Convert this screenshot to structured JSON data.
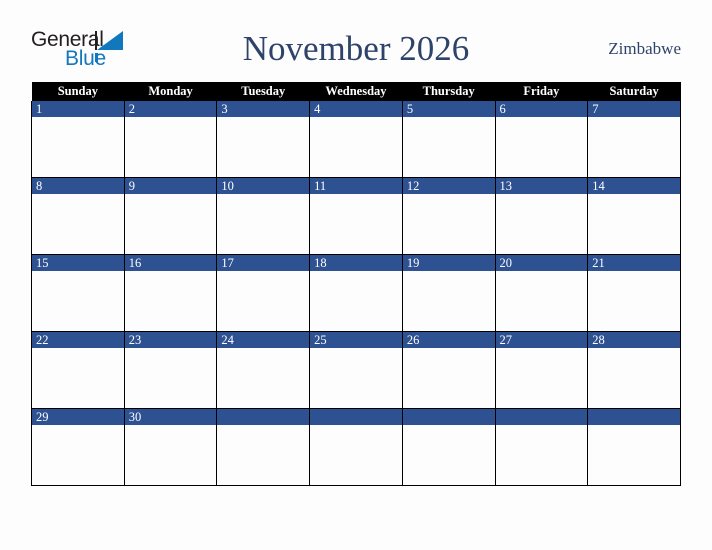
{
  "logo": {
    "word_one": "General",
    "word_two": "Blue",
    "triangle_icon": "blue-triangle-icon",
    "color_dark": "#231f20",
    "color_blue": "#1278be"
  },
  "header": {
    "title": "November 2026",
    "country": "Zimbabwe",
    "title_color": "#2e4369"
  },
  "calendar": {
    "weekday_headers": [
      "Sunday",
      "Monday",
      "Tuesday",
      "Wednesday",
      "Thursday",
      "Friday",
      "Saturday"
    ],
    "header_bg": "#000000",
    "header_text_color": "#ffffff",
    "daynum_bg": "#2e5192",
    "daynum_text_color": "#ffffff",
    "cell_bg": "#fdfdfd",
    "grid_line_color": "#000000",
    "weeks": [
      [
        {
          "day": "1"
        },
        {
          "day": "2"
        },
        {
          "day": "3"
        },
        {
          "day": "4"
        },
        {
          "day": "5"
        },
        {
          "day": "6"
        },
        {
          "day": "7"
        }
      ],
      [
        {
          "day": "8"
        },
        {
          "day": "9"
        },
        {
          "day": "10"
        },
        {
          "day": "11"
        },
        {
          "day": "12"
        },
        {
          "day": "13"
        },
        {
          "day": "14"
        }
      ],
      [
        {
          "day": "15"
        },
        {
          "day": "16"
        },
        {
          "day": "17"
        },
        {
          "day": "18"
        },
        {
          "day": "19"
        },
        {
          "day": "20"
        },
        {
          "day": "21"
        }
      ],
      [
        {
          "day": "22"
        },
        {
          "day": "23"
        },
        {
          "day": "24"
        },
        {
          "day": "25"
        },
        {
          "day": "26"
        },
        {
          "day": "27"
        },
        {
          "day": "28"
        }
      ],
      [
        {
          "day": "29"
        },
        {
          "day": "30"
        },
        {
          "day": ""
        },
        {
          "day": ""
        },
        {
          "day": ""
        },
        {
          "day": ""
        },
        {
          "day": ""
        }
      ]
    ]
  }
}
